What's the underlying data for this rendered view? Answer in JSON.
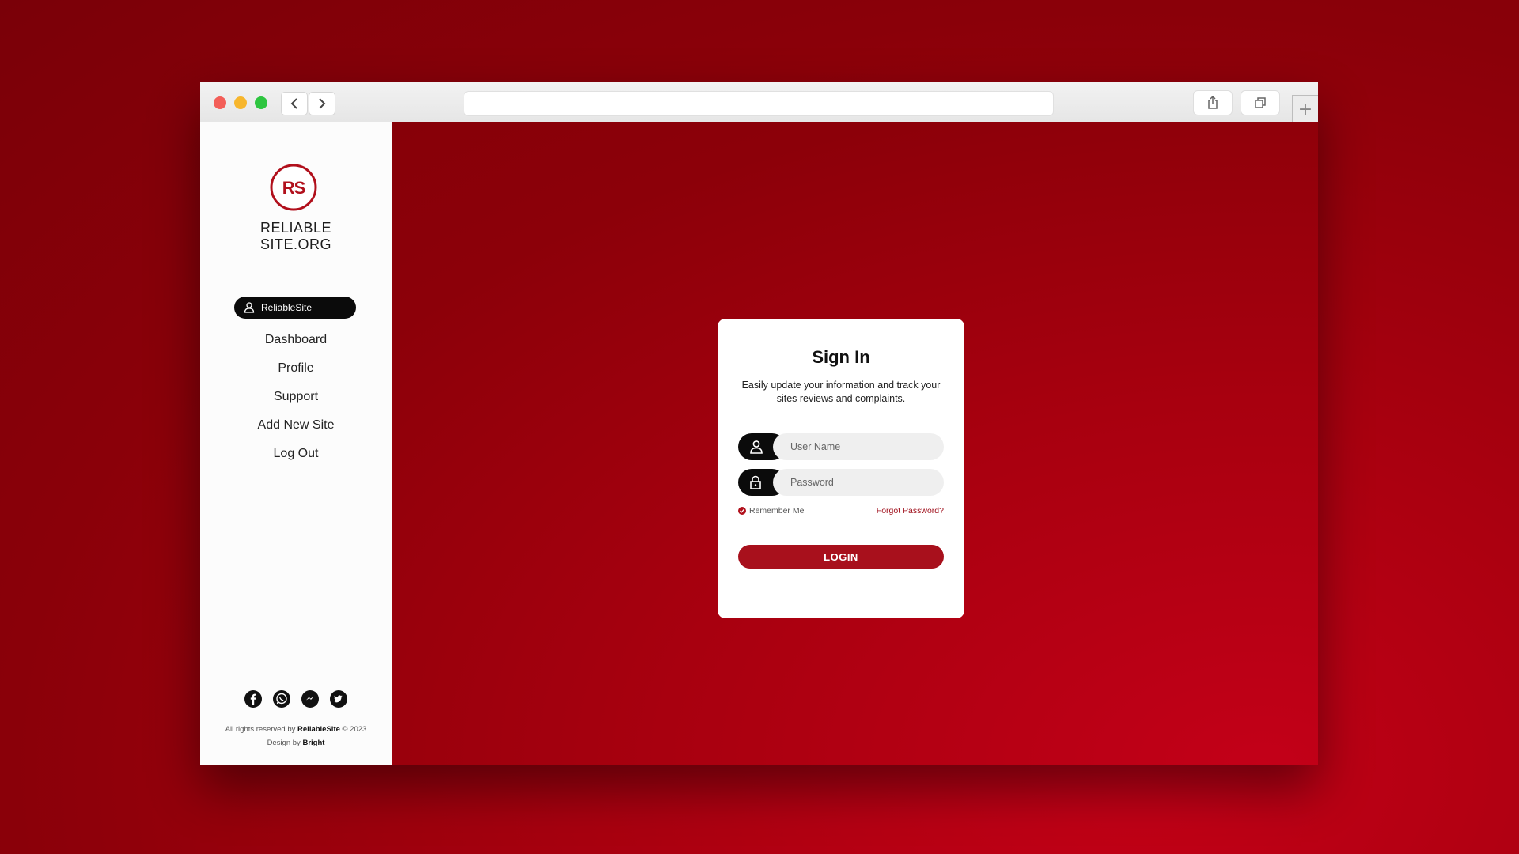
{
  "browser": {
    "back_glyph": "‹",
    "forward_glyph": "›",
    "url": "",
    "new_tab_glyph": "+"
  },
  "sidebar": {
    "logo_text": "RS",
    "brand_line1": "RELIABLE",
    "brand_line2": "SITE.ORG",
    "user_label": "ReliableSite",
    "menu": [
      "Dashboard",
      "Profile",
      "Support",
      "Add New Site",
      "Log Out"
    ],
    "social_icons": [
      "facebook-icon",
      "whatsapp-icon",
      "messenger-icon",
      "twitter-icon"
    ],
    "footer_prefix": "All rights reserved by",
    "footer_brand": "ReliableSite",
    "footer_year": "© 2023",
    "design_prefix": "Design by",
    "design_brand": "Bright"
  },
  "signin": {
    "title": "Sign In",
    "subtitle": "Easily update your information and track your sites reviews and complaints.",
    "username_placeholder": "User Name",
    "password_placeholder": "Password",
    "remember_label": "Remember Me",
    "forgot_label": "Forgot Password?",
    "login_label": "LOGIN"
  },
  "colors": {
    "accent": "#a8101c",
    "background": "#9a000d",
    "sidebar": "#fcfcfc"
  }
}
